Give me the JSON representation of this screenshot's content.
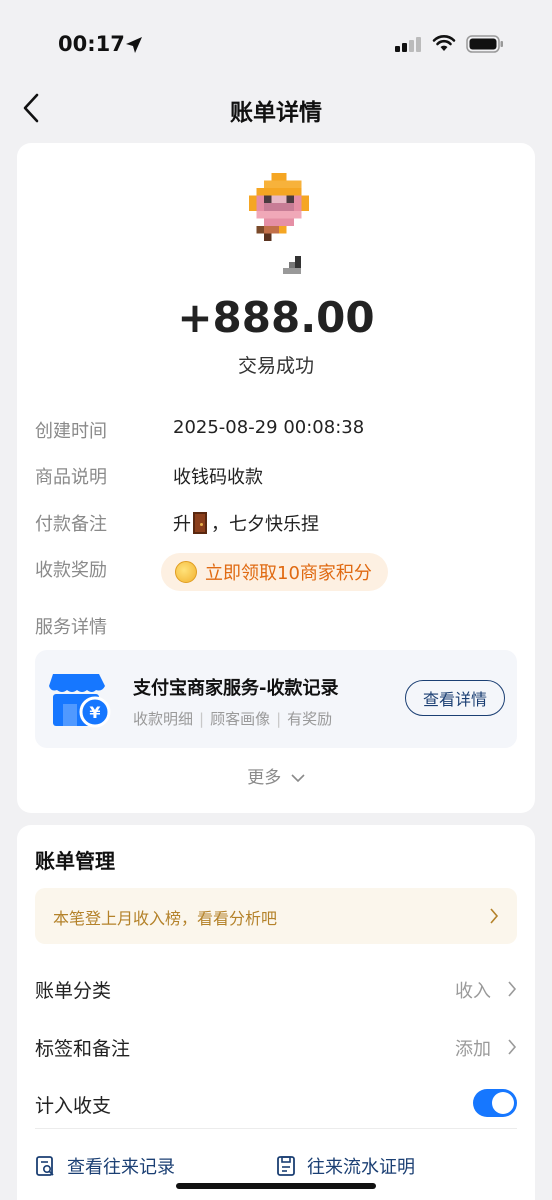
{
  "status_bar": {
    "time": "00:17"
  },
  "nav": {
    "title": "账单详情",
    "back_icon": "chevron-left-icon"
  },
  "transaction": {
    "amount": "+888.00",
    "status": "交易成功",
    "details": [
      {
        "label": "创建时间",
        "value": "2025-08-29 00:08:38"
      },
      {
        "label": "商品说明",
        "value": "收钱码收款"
      },
      {
        "label": "付款备注",
        "value_prefix": "升",
        "value_suffix": "，七夕快乐捏",
        "emoji": "door-icon"
      }
    ],
    "reward": {
      "label": "收款奖励",
      "text": "立即领取10商家积分"
    },
    "service": {
      "label": "服务详情",
      "title": "支付宝商家服务-收款记录",
      "tags": [
        "收款明细",
        "顾客画像",
        "有奖励"
      ],
      "button": "查看详情"
    },
    "more": "更多"
  },
  "management": {
    "title": "账单管理",
    "tip": "本笔登上月收入榜，看看分析吧",
    "rows": [
      {
        "label": "账单分类",
        "value": "收入"
      },
      {
        "label": "标签和备注",
        "value": "添加"
      },
      {
        "label": "计入收支"
      }
    ],
    "toggle_on": true,
    "links": [
      "查看往来记录",
      "往来流水证明"
    ]
  },
  "colors": {
    "accent": "#1677ff",
    "link": "#1b3f73",
    "reward_text": "#e06a12",
    "tip_text": "#b4822a"
  }
}
